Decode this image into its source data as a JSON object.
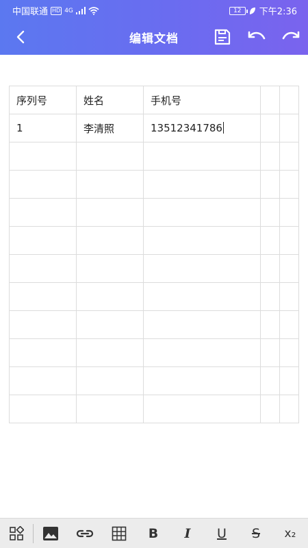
{
  "status_bar": {
    "carrier": "中国联通",
    "hd": "HD",
    "signal_label": "4G",
    "battery": "12",
    "time": "下午2:36"
  },
  "header": {
    "title": "编辑文档",
    "back_icon": "chevron-left-icon",
    "save_icon": "save-icon",
    "undo_icon": "undo-icon",
    "redo_icon": "redo-icon"
  },
  "table": {
    "rows": [
      [
        "序列号",
        "姓名",
        "手机号",
        "",
        ""
      ],
      [
        "1",
        "李清照",
        "13512341786",
        "",
        ""
      ],
      [
        "",
        "",
        "",
        "",
        ""
      ],
      [
        "",
        "",
        "",
        "",
        ""
      ],
      [
        "",
        "",
        "",
        "",
        ""
      ],
      [
        "",
        "",
        "",
        "",
        ""
      ],
      [
        "",
        "",
        "",
        "",
        ""
      ],
      [
        "",
        "",
        "",
        "",
        ""
      ],
      [
        "",
        "",
        "",
        "",
        ""
      ],
      [
        "",
        "",
        "",
        "",
        ""
      ],
      [
        "",
        "",
        "",
        "",
        ""
      ],
      [
        "",
        "",
        "",
        "",
        ""
      ]
    ]
  },
  "format_bar": {
    "bold": "B",
    "italic": "I",
    "underline": "U",
    "strike": "S",
    "subscript": "x₂",
    "icons": [
      "grid-layout-icon",
      "image-icon",
      "link-icon",
      "table-icon",
      "bold-icon",
      "italic-icon",
      "underline-icon",
      "strikethrough-icon",
      "subscript-icon"
    ]
  }
}
